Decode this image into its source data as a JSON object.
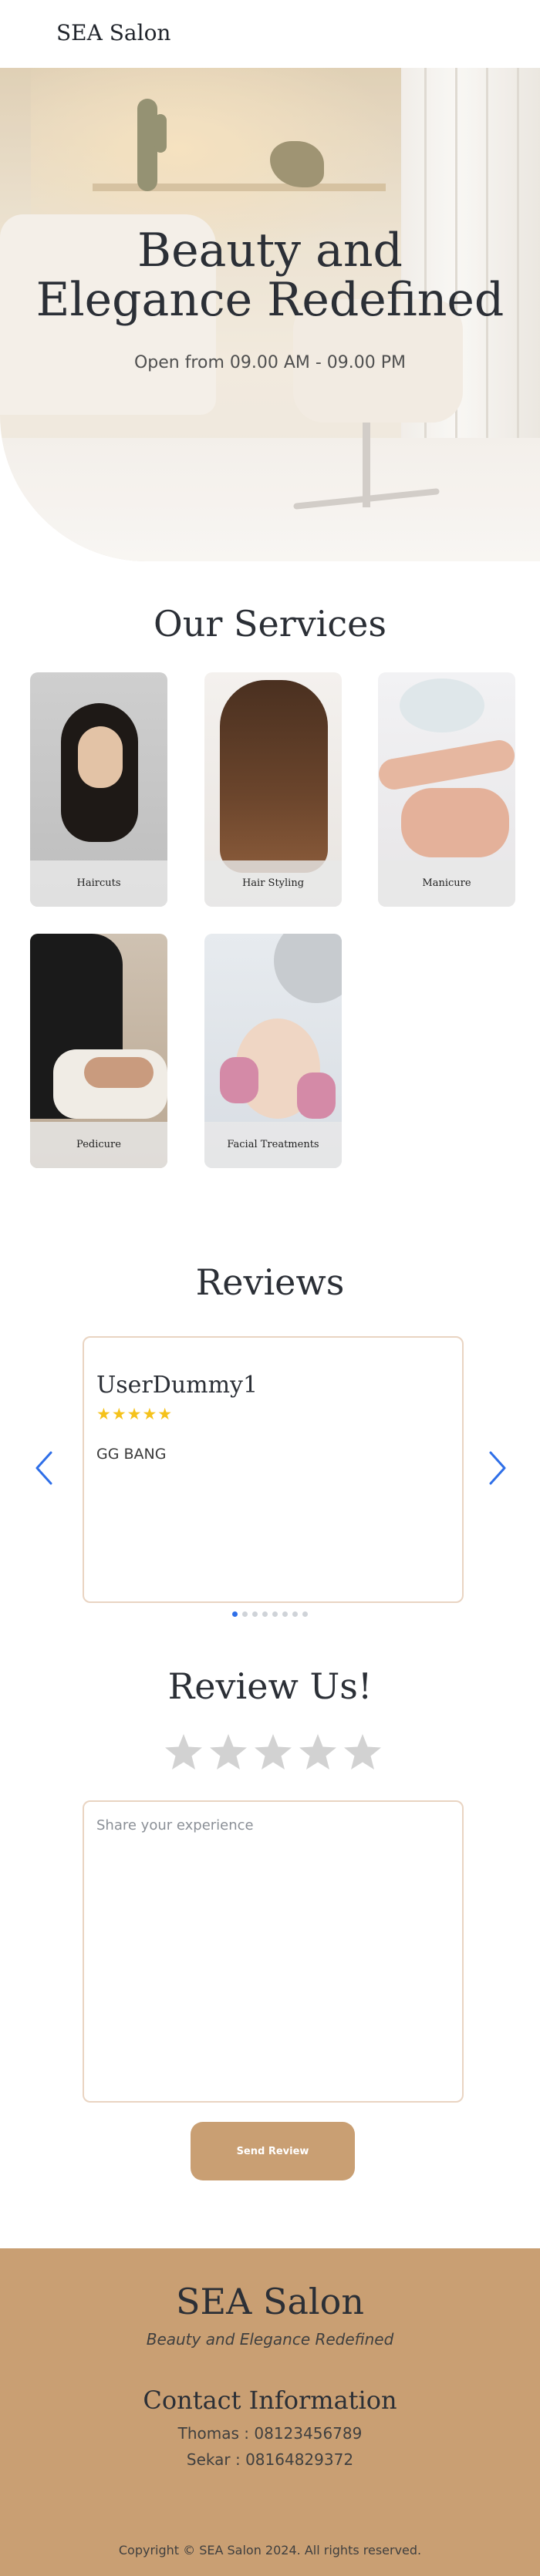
{
  "header": {
    "brand": "SEA Salon"
  },
  "hero": {
    "title_line1": "Beauty and",
    "title_line2": "Elegance Redefined",
    "hours": "Open from 09.00 AM - 09.00 PM"
  },
  "services": {
    "title": "Our Services",
    "items": [
      {
        "label": "Haircuts"
      },
      {
        "label": "Hair Styling"
      },
      {
        "label": "Manicure"
      },
      {
        "label": "Pedicure"
      },
      {
        "label": "Facial Treatments"
      }
    ]
  },
  "reviews": {
    "title": "Reviews",
    "current": {
      "user": "UserDummy1",
      "stars": "★★★★★",
      "rating": 5,
      "text": "GG BANG"
    },
    "carousel": {
      "total": 8,
      "active_index": 0
    },
    "prev_icon": "chevron-left-icon",
    "next_icon": "chevron-right-icon",
    "accent": "#2f6fe8"
  },
  "review_form": {
    "title": "Review Us!",
    "rating": 0,
    "max_rating": 5,
    "placeholder": "Share your experience",
    "submit_label": "Send Review"
  },
  "footer": {
    "brand": "SEA Salon",
    "tagline": "Beauty and Elegance Redefined",
    "contact_title": "Contact Information",
    "contacts": [
      "Thomas : 08123456789",
      "Sekar : 08164829372"
    ],
    "copyright": "Copyright © SEA Salon 2024. All rights reserved."
  },
  "colors": {
    "brand_tan": "#c99f73",
    "border": "#e9d4c2",
    "star_filled": "#f5c21b",
    "star_empty": "#d2d2d2",
    "heading": "#2b2f36"
  }
}
